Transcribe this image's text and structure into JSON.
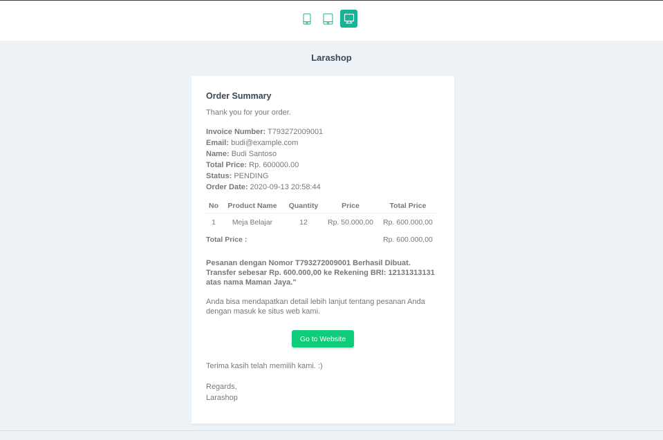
{
  "toolbar": {
    "devices": [
      {
        "name": "mobile",
        "icon": "mobile-icon",
        "active": false
      },
      {
        "name": "tablet",
        "icon": "tablet-icon",
        "active": false
      },
      {
        "name": "desktop",
        "icon": "desktop-icon",
        "active": true
      }
    ],
    "accent": "#18b394"
  },
  "email": {
    "brand": "Larashop",
    "heading": "Order Summary",
    "thanks": "Thank you for your order.",
    "details": [
      {
        "label": "Invoice Number:",
        "value": "T793272009001"
      },
      {
        "label": "Email:",
        "value": "budi@example.com"
      },
      {
        "label": "Name:",
        "value": "Budi Santoso"
      },
      {
        "label": "Total Price:",
        "value": "Rp. 600000.00"
      },
      {
        "label": "Status:",
        "value": "PENDING"
      },
      {
        "label": "Order Date:",
        "value": "2020-09-13 20:58:44"
      }
    ],
    "table": {
      "headers": [
        "No",
        "Product Name",
        "Quantity",
        "Price",
        "Total Price"
      ],
      "rows": [
        [
          "1",
          "Meja Belajar",
          "12",
          "Rp. 50.000,00",
          "Rp. 600.000,00"
        ]
      ],
      "total_label": "Total Price :",
      "total_value": "Rp. 600.000,00"
    },
    "notice": "Pesanan dengan Nomor T793272009001 Berhasil Dibuat. Transfer sebesar Rp. 600.000,00 ke Rekening BRI: 12131313131 atas nama Maman Jaya.\"",
    "info": "Anda bisa mendapatkan detail lebih lanjut tentang pesanan Anda dengan masuk ke situs web kami.",
    "button_label": "Go to Website",
    "button_color": "#0fcc7a",
    "closing": "Terima kasih telah memilih kami. :)",
    "regards": "Regards,",
    "signature": "Larashop"
  }
}
